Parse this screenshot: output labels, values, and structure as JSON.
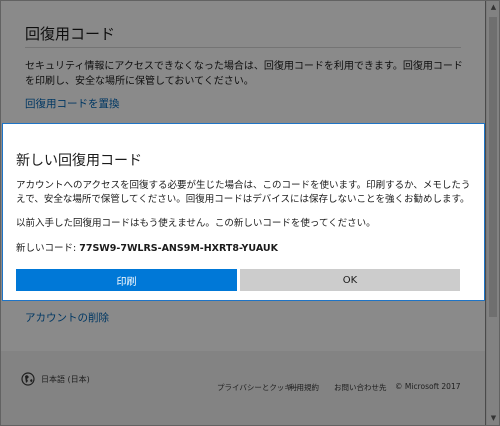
{
  "page": {
    "title": "回復用コード",
    "description": "セキュリティ情報にアクセスできなくなった場合は、回復用コードを利用できます。回復用コードを印刷し、安全な場所に保管しておいてください。",
    "replace_link": "回復用コードを置換",
    "delete_link": "アカウントの削除"
  },
  "footer": {
    "language": "日本語 (日本)",
    "links": [
      "プライバシーとクッキー",
      "利用規約",
      "お問い合わせ先"
    ],
    "copyright": "© Microsoft 2017"
  },
  "dialog": {
    "title": "新しい回復用コード",
    "body": "アカウントへのアクセスを回復する必要が生じた場合は、このコードを使います。印刷するか、メモしたうえで、安全な場所で保管してください。回復用コードはデバイスには保存しないことを強くお勧めします。",
    "note": "以前入手した回復用コードはもう使えません。この新しいコードを使ってください。",
    "code_label": "新しいコード:",
    "code_value": "77SW9-7WLRS-ANS9M-HXRT8-YUAUK",
    "print_label": "印刷",
    "ok_label": "OK"
  },
  "colors": {
    "accent": "#0078d7",
    "link": "#0067b8",
    "dialog_border": "#1e74c6"
  }
}
